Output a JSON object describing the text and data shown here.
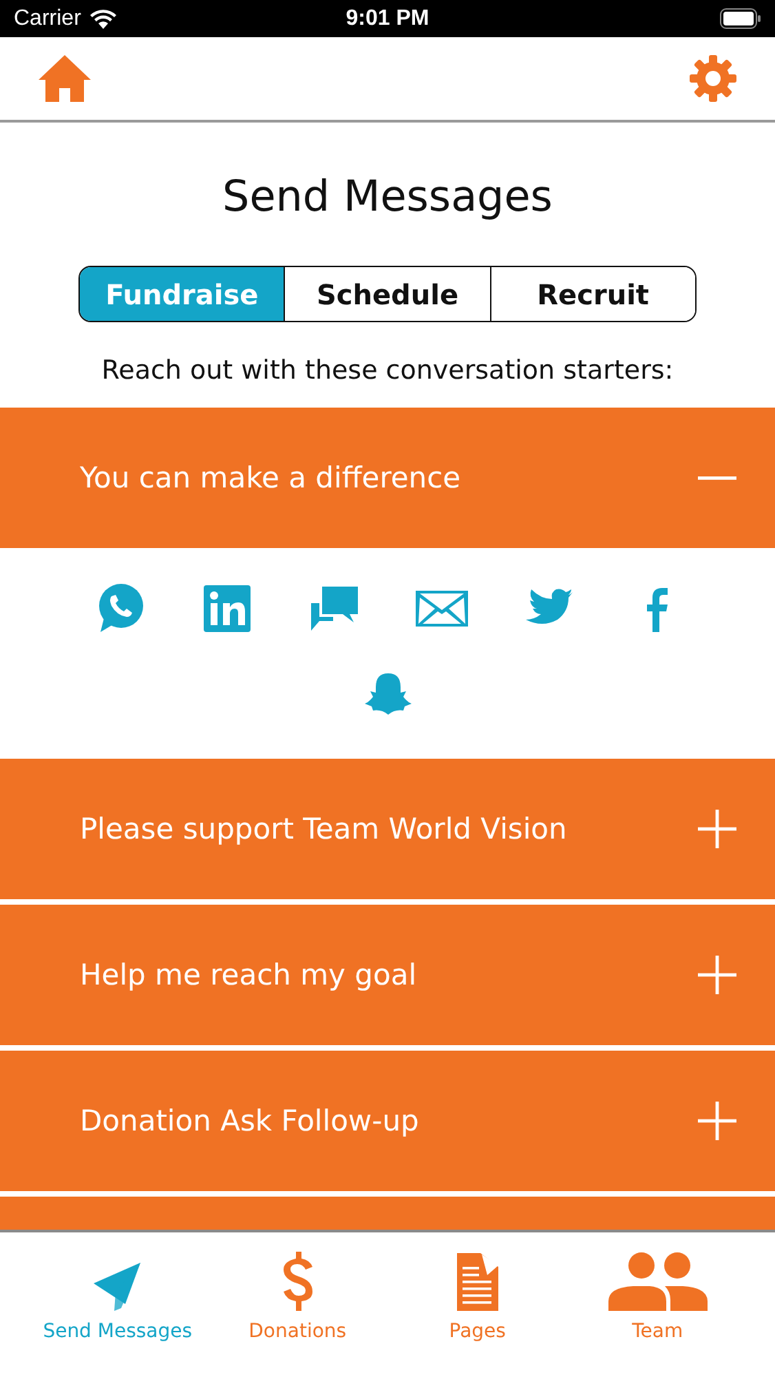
{
  "status_bar": {
    "carrier": "Carrier",
    "time": "9:01 PM"
  },
  "title": "Send Messages",
  "tabs": [
    {
      "label": "Fundraise",
      "selected": true
    },
    {
      "label": "Schedule",
      "selected": false
    },
    {
      "label": "Recruit",
      "selected": false
    }
  ],
  "intro": "Reach out with these conversation starters:",
  "starters": [
    {
      "label": "You can make a difference",
      "expanded": true,
      "share": [
        {
          "kind": "whatsapp"
        },
        {
          "kind": "linkedin"
        },
        {
          "kind": "chat"
        },
        {
          "kind": "email"
        },
        {
          "kind": "twitter"
        },
        {
          "kind": "facebook"
        },
        {
          "kind": "snapchat"
        }
      ]
    },
    {
      "label": "Please support Team World Vision",
      "expanded": false
    },
    {
      "label": "Help me reach my goal",
      "expanded": false
    },
    {
      "label": "Donation Ask Follow-up",
      "expanded": false
    }
  ],
  "tab_bar": [
    {
      "kind": "send",
      "label": "Send Messages",
      "selected": true
    },
    {
      "kind": "donations",
      "label": "Donations",
      "selected": false
    },
    {
      "kind": "pages",
      "label": "Pages",
      "selected": false
    },
    {
      "kind": "team",
      "label": "Team",
      "selected": false
    }
  ]
}
